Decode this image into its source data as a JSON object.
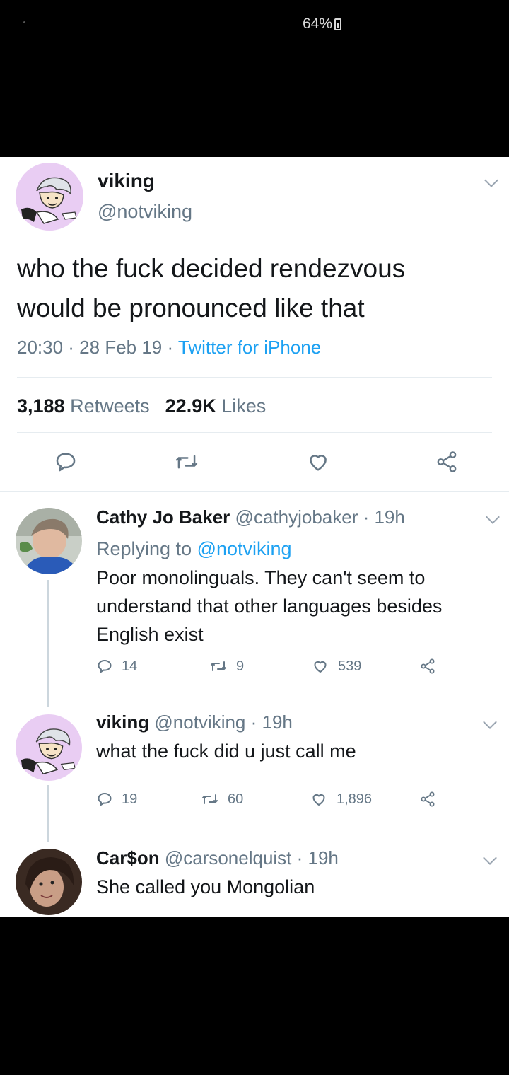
{
  "status_bar": {
    "battery": "64%"
  },
  "main_tweet": {
    "name": "viking",
    "handle": "@notviking",
    "text_line1": "who the fuck decided rendezvous",
    "text_line2": "would be pronounced like that",
    "time": "20:30 · 28 Feb 19 · ",
    "source": "Twitter for iPhone",
    "retweets_count": "3,188",
    "retweets_label": "Retweets",
    "likes_count": "22.9K",
    "likes_label": "Likes"
  },
  "replies": [
    {
      "name": "Cathy Jo Baker",
      "handle_time": "@cathyjobaker · 19h",
      "replying_prefix": "Replying to ",
      "replying_to": "@notviking",
      "lines": [
        "Poor monolinguals. They can't seem to",
        "understand that other languages besides",
        "English exist"
      ],
      "replies": "14",
      "retweets": "9",
      "likes": "539"
    },
    {
      "name": "viking",
      "handle_time": "@notviking · 19h",
      "lines": [
        "what the fuck did u just call me"
      ],
      "replies": "19",
      "retweets": "60",
      "likes": "1,896"
    },
    {
      "name": "Car$on",
      "handle_time": "@carsonelquist · 19h",
      "lines": [
        "She called you Mongolian"
      ]
    }
  ],
  "icons": [
    "reply-icon",
    "retweet-icon",
    "like-icon",
    "share-icon",
    "chevron-down-icon"
  ],
  "colors": {
    "accent": "#1da1f2",
    "muted": "#657786",
    "text": "#14171a"
  }
}
